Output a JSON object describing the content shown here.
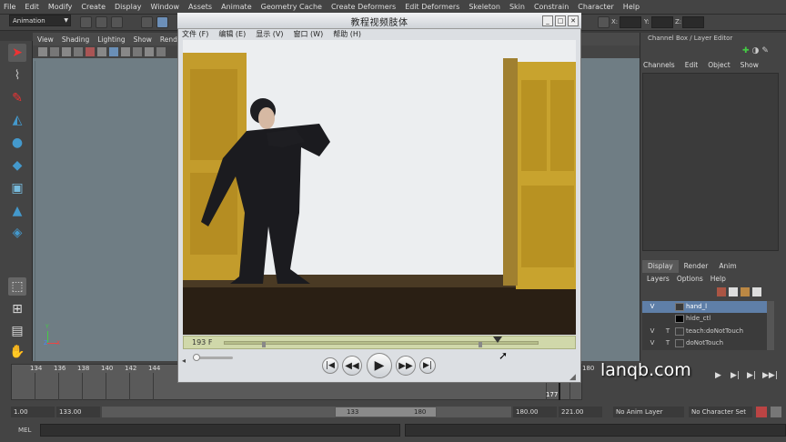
{
  "maya": {
    "menubar": [
      "File",
      "Edit",
      "Modify",
      "Create",
      "Display",
      "Window",
      "Assets",
      "Animate",
      "Geometry Cache",
      "Create Deformers",
      "Edit Deformers",
      "Skeleton",
      "Skin",
      "Constrain",
      "Character",
      "Help"
    ],
    "mode_selector": "Animation",
    "coord_labels": {
      "x": "X:",
      "y": "Y:",
      "z": "Z:"
    },
    "viewport_menu": [
      "View",
      "Shading",
      "Lighting",
      "Show",
      "Renderer"
    ],
    "axis_labels": {
      "y": "Y",
      "z": "Z",
      "x": "X"
    },
    "right_panel": {
      "title": "Channel Box / Layer Editor",
      "tabs": [
        "Channels",
        "Edit",
        "Object",
        "Show"
      ],
      "layer_tabs": [
        "Display",
        "Render",
        "Anim"
      ],
      "layer_menu": [
        "Layers",
        "Options",
        "Help"
      ],
      "layers": [
        {
          "v": "V",
          "t": "",
          "name": "hand_l",
          "selected": true
        },
        {
          "v": "",
          "t": "",
          "name": "hide_ctl",
          "selected": false
        },
        {
          "v": "V",
          "t": "T",
          "name": "teach:doNotTouch",
          "selected": false
        },
        {
          "v": "V",
          "t": "T",
          "name": "doNotTouch",
          "selected": false
        }
      ]
    },
    "timeline": {
      "ticks": [
        "134",
        "136",
        "138",
        "140",
        "142",
        "144",
        "180"
      ],
      "current_frame": "177"
    },
    "range_slider": {
      "start_time": "1.00",
      "playback_start": "133.00",
      "range_start": "133",
      "range_end": "180",
      "playback_end": "180.00",
      "end_time": "221.00",
      "anim_layer": "No Anim Layer",
      "character_set": "No Character Set"
    },
    "command_line": {
      "label": "MEL"
    }
  },
  "player": {
    "title": "教程视频肢体",
    "menu": [
      "文件 (F)",
      "编辑 (E)",
      "显示 (V)",
      "窗口 (W)",
      "帮助 (H)"
    ],
    "frame_label": "193 F",
    "seek_position": 0.87
  },
  "watermark": "lanqb.com",
  "colors": {
    "maya_bg": "#444444",
    "viewport_bg": "#6f7d84",
    "player_chrome": "#dcdfe3",
    "seekbar": "#d0d8aa",
    "selected_layer": "#5f7fa8",
    "door_yellow": "#c9a227"
  }
}
